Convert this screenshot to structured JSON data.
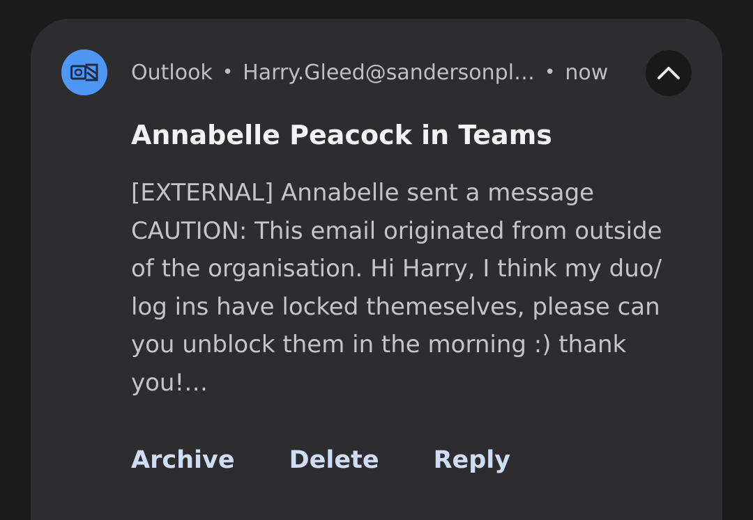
{
  "notification": {
    "app_name": "Outlook",
    "account": "Harry.Gleed@sandersonpl…",
    "separator": "•",
    "time": "now",
    "title": "Annabelle Peacock in Teams",
    "body_lines": [
      "[EXTERNAL] Annabelle sent a message",
      "CAUTION: This email originated from outside",
      "of the organisation. Hi Harry, I think my duo/",
      "log ins have locked themeselves, please can",
      "you unblock them in the morning :) thank",
      "you!…"
    ],
    "app_icon": "outlook-icon",
    "collapse_icon": "chevron-up-icon",
    "actions": {
      "archive": "Archive",
      "delete": "Delete",
      "reply": "Reply"
    }
  },
  "colors": {
    "background": "#1b1b1c",
    "card": "#2d2d2f",
    "app_icon_bg": "#4f97f4",
    "action_text": "#cfdcf6"
  }
}
